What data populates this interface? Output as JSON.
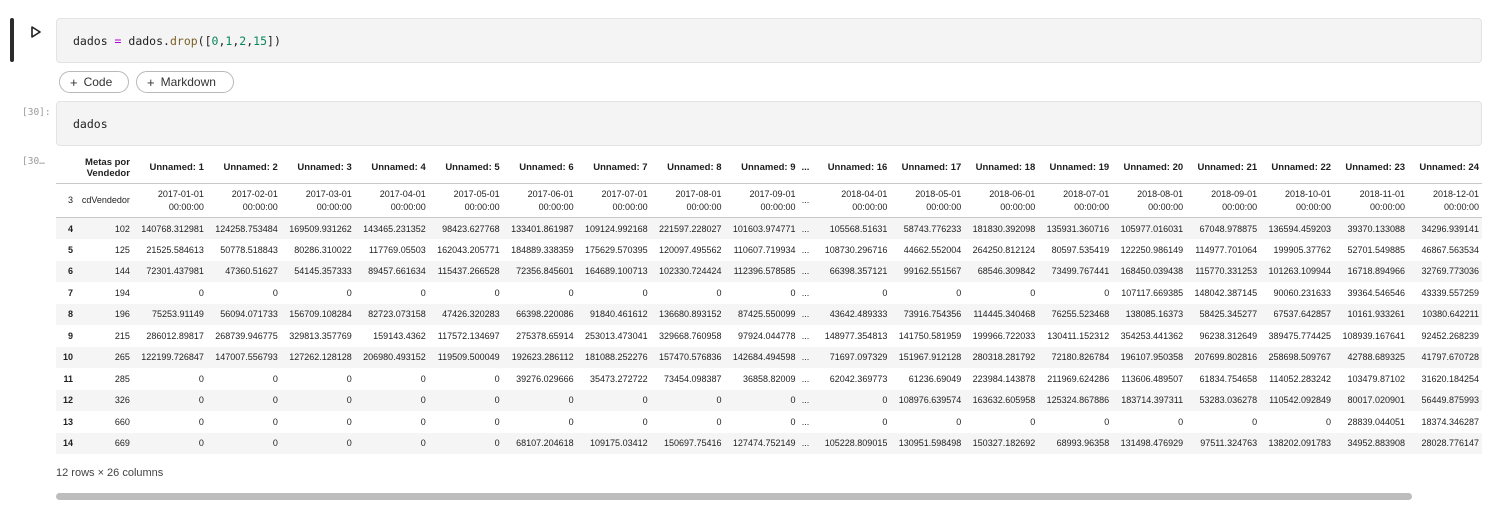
{
  "cells": [
    {
      "code": [
        {
          "t": "dados",
          "c": "id"
        },
        {
          "t": " = ",
          "c": "op"
        },
        {
          "t": "dados",
          "c": "id"
        },
        {
          "t": ".",
          "c": "id"
        },
        {
          "t": "drop",
          "c": "fn"
        },
        {
          "t": "([",
          "c": "id"
        },
        {
          "t": "0",
          "c": "num"
        },
        {
          "t": ",",
          "c": "id"
        },
        {
          "t": "1",
          "c": "num"
        },
        {
          "t": ",",
          "c": "id"
        },
        {
          "t": "2",
          "c": "num"
        },
        {
          "t": ",",
          "c": "id"
        },
        {
          "t": "15",
          "c": "num"
        },
        {
          "t": "])",
          "c": "id"
        }
      ]
    },
    {
      "exec_count": "[30]:",
      "code": [
        {
          "t": "dados",
          "c": "id"
        }
      ]
    }
  ],
  "add_buttons": {
    "code": "Code",
    "markdown": "Markdown"
  },
  "output_exec_count": "[30…",
  "table": {
    "header1": [
      "",
      "Metas por Vendedor",
      "Unnamed: 1",
      "Unnamed: 2",
      "Unnamed: 3",
      "Unnamed: 4",
      "Unnamed: 5",
      "Unnamed: 6",
      "Unnamed: 7",
      "Unnamed: 8",
      "Unnamed: 9",
      "...",
      "Unnamed: 16",
      "Unnamed: 17",
      "Unnamed: 18",
      "Unnamed: 19",
      "Unnamed: 20",
      "Unnamed: 21",
      "Unnamed: 22",
      "Unnamed: 23",
      "Unnamed: 24"
    ],
    "header2": [
      "3",
      "cdVendedor",
      "2017-01-01 00:00:00",
      "2017-02-01 00:00:00",
      "2017-03-01 00:00:00",
      "2017-04-01 00:00:00",
      "2017-05-01 00:00:00",
      "2017-06-01 00:00:00",
      "2017-07-01 00:00:00",
      "2017-08-01 00:00:00",
      "2017-09-01 00:00:00",
      "...",
      "2018-04-01 00:00:00",
      "2018-05-01 00:00:00",
      "2018-06-01 00:00:00",
      "2018-07-01 00:00:00",
      "2018-08-01 00:00:00",
      "2018-09-01 00:00:00",
      "2018-10-01 00:00:00",
      "2018-11-01 00:00:00",
      "2018-12-01 00:00:00"
    ],
    "rows": [
      [
        "4",
        "102",
        "140768.312981",
        "124258.753484",
        "169509.931262",
        "143465.231352",
        "98423.627768",
        "133401.861987",
        "109124.992168",
        "221597.228027",
        "101603.974771",
        "...",
        "105568.51631",
        "58743.776233",
        "181830.392098",
        "135931.360716",
        "105977.016031",
        "67048.978875",
        "136594.459203",
        "39370.133088",
        "34296.939141"
      ],
      [
        "5",
        "125",
        "21525.584613",
        "50778.518843",
        "80286.310022",
        "117769.05503",
        "162043.205771",
        "184889.338359",
        "175629.570395",
        "120097.495562",
        "110607.719934",
        "...",
        "108730.296716",
        "44662.552004",
        "264250.812124",
        "80597.535419",
        "122250.986149",
        "114977.701064",
        "199905.37762",
        "52701.549885",
        "46867.563534"
      ],
      [
        "6",
        "144",
        "72301.437981",
        "47360.51627",
        "54145.357333",
        "89457.661634",
        "115437.266528",
        "72356.845601",
        "164689.100713",
        "102330.724424",
        "112396.578585",
        "...",
        "66398.357121",
        "99162.551567",
        "68546.309842",
        "73499.767441",
        "168450.039438",
        "115770.331253",
        "101263.109944",
        "16718.894966",
        "32769.773036"
      ],
      [
        "7",
        "194",
        "0",
        "0",
        "0",
        "0",
        "0",
        "0",
        "0",
        "0",
        "0",
        "...",
        "0",
        "0",
        "0",
        "0",
        "107117.669385",
        "148042.387145",
        "90060.231633",
        "39364.546546",
        "43339.557259"
      ],
      [
        "8",
        "196",
        "75253.91149",
        "56094.071733",
        "156709.108284",
        "82723.073158",
        "47426.320283",
        "66398.220086",
        "91840.461612",
        "136680.893152",
        "87425.550099",
        "...",
        "43642.489333",
        "73916.754356",
        "114445.340468",
        "76255.523468",
        "138085.16373",
        "58425.345277",
        "67537.642857",
        "10161.933261",
        "10380.642211"
      ],
      [
        "9",
        "215",
        "286012.89817",
        "268739.946775",
        "329813.357769",
        "159143.4362",
        "117572.134697",
        "275378.65914",
        "253013.473041",
        "329668.760958",
        "97924.044778",
        "...",
        "148977.354813",
        "141750.581959",
        "199966.722033",
        "130411.152312",
        "354253.441362",
        "96238.312649",
        "389475.774425",
        "108939.167641",
        "92452.268239"
      ],
      [
        "10",
        "265",
        "122199.726847",
        "147007.556793",
        "127262.128128",
        "206980.493152",
        "119509.500049",
        "192623.286112",
        "181088.252276",
        "157470.576836",
        "142684.494598",
        "...",
        "71697.097329",
        "151967.912128",
        "280318.281792",
        "72180.826784",
        "196107.950358",
        "207699.802816",
        "258698.509767",
        "42788.689325",
        "41797.670728"
      ],
      [
        "11",
        "285",
        "0",
        "0",
        "0",
        "0",
        "0",
        "39276.029666",
        "35473.272722",
        "73454.098387",
        "36858.82009",
        "...",
        "62042.369773",
        "61236.69049",
        "223984.143878",
        "211969.624286",
        "113606.489507",
        "61834.754658",
        "114052.283242",
        "103479.87102",
        "31620.184254"
      ],
      [
        "12",
        "326",
        "0",
        "0",
        "0",
        "0",
        "0",
        "0",
        "0",
        "0",
        "0",
        "...",
        "0",
        "108976.639574",
        "163632.605958",
        "125324.867886",
        "183714.397311",
        "53283.036278",
        "110542.092849",
        "80017.020901",
        "56449.875993"
      ],
      [
        "13",
        "660",
        "0",
        "0",
        "0",
        "0",
        "0",
        "0",
        "0",
        "0",
        "0",
        "...",
        "0",
        "0",
        "0",
        "0",
        "0",
        "0",
        "0",
        "28839.044051",
        "18374.346287"
      ],
      [
        "14",
        "669",
        "0",
        "0",
        "0",
        "0",
        "0",
        "68107.204618",
        "109175.03412",
        "150697.75416",
        "127474.752149",
        "...",
        "105228.809015",
        "130951.598498",
        "150327.182692",
        "68993.96358",
        "131498.476929",
        "97511.324763",
        "138202.091783",
        "34952.883908",
        "28028.776147"
      ]
    ]
  },
  "shape_note": "12 rows × 26 columns"
}
